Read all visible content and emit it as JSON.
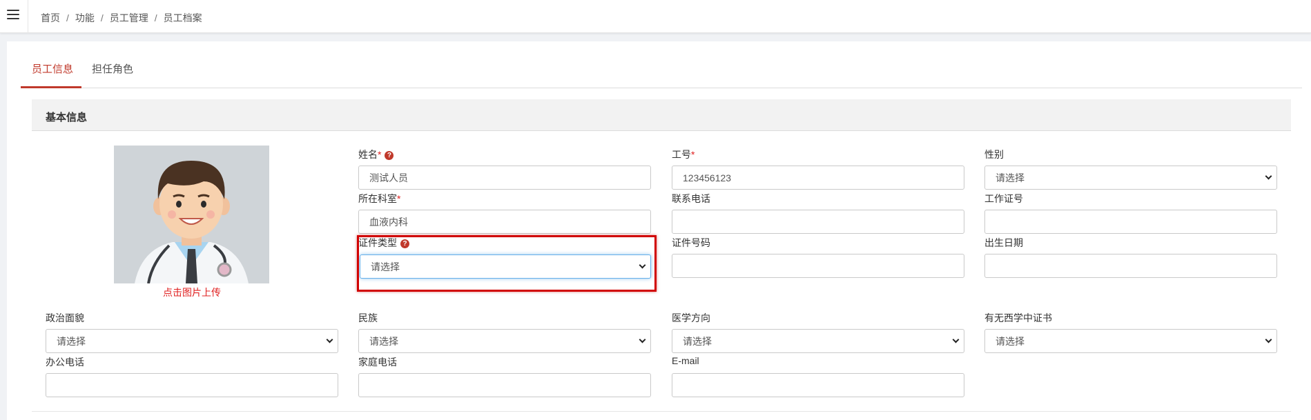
{
  "topbar": {
    "breadcrumb": [
      "首页",
      "功能",
      "员工管理",
      "员工档案"
    ],
    "separator": "/"
  },
  "tabs": [
    {
      "label": "员工信息",
      "active": true
    },
    {
      "label": "担任角色",
      "active": false
    }
  ],
  "section": {
    "title": "基本信息"
  },
  "avatar": {
    "upload_hint": "点击图片上传"
  },
  "form": {
    "name": {
      "label": "姓名",
      "required_mark": "*",
      "value": "测试人员"
    },
    "emp_no": {
      "label": "工号",
      "required_mark": "*",
      "value": "123456123"
    },
    "gender": {
      "label": "性别",
      "selected": "请选择"
    },
    "dept": {
      "label": "所在科室",
      "required_mark": "*",
      "value": "血液内科"
    },
    "phone": {
      "label": "联系电话",
      "value": ""
    },
    "work_cert": {
      "label": "工作证号",
      "value": ""
    },
    "id_type": {
      "label": "证件类型",
      "selected": "请选择"
    },
    "id_no": {
      "label": "证件号码",
      "value": ""
    },
    "birth": {
      "label": "出生日期",
      "value": ""
    },
    "political": {
      "label": "政治面貌",
      "selected": "请选择"
    },
    "ethnic": {
      "label": "民族",
      "selected": "请选择"
    },
    "medical_dir": {
      "label": "医学方向",
      "selected": "请选择"
    },
    "cert_wm": {
      "label": "有无西学中证书",
      "selected": "请选择"
    },
    "office_phone": {
      "label": "办公电话",
      "value": ""
    },
    "home_phone": {
      "label": "家庭电话",
      "value": ""
    },
    "email": {
      "label": "E-mail",
      "value": ""
    }
  },
  "colors": {
    "accent": "#c0392b",
    "required": "#e02020",
    "highlight": "#d10000"
  },
  "icons": {
    "menu": "hamburger-icon",
    "help": "question-circle-icon",
    "select": "chevron-down-icon"
  }
}
